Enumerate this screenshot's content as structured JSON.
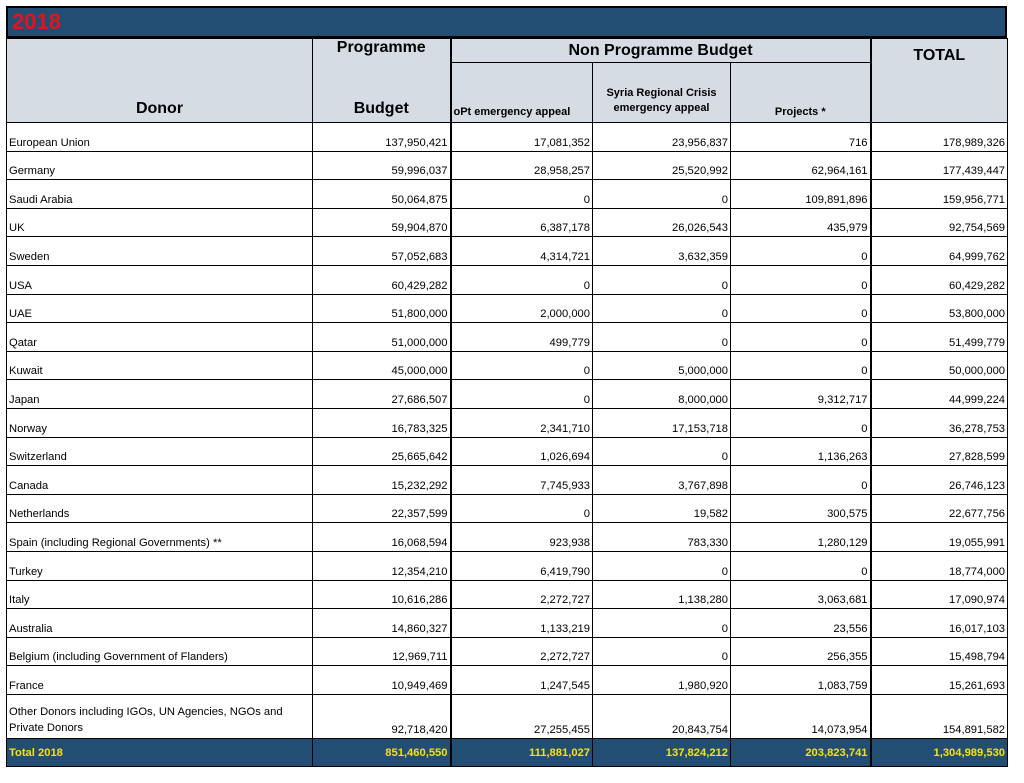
{
  "title": "2018",
  "headers": {
    "donor": "Donor",
    "programme_line1": "Programme",
    "programme_line2": "Budget",
    "non_programme": "Non Programme Budget",
    "opt": "oPt emergency appeal",
    "syria": "Syria Regional Crisis emergency appeal",
    "projects": "Projects *",
    "total": "TOTAL"
  },
  "rows": [
    {
      "donor": "European Union",
      "programme": "137,950,421",
      "opt": "17,081,352",
      "syria": "23,956,837",
      "projects": "716",
      "total": "178,989,326"
    },
    {
      "donor": "Germany",
      "programme": "59,996,037",
      "opt": "28,958,257",
      "syria": "25,520,992",
      "projects": "62,964,161",
      "total": "177,439,447"
    },
    {
      "donor": "Saudi Arabia",
      "programme": "50,064,875",
      "opt": "0",
      "syria": "0",
      "projects": "109,891,896",
      "total": "159,956,771"
    },
    {
      "donor": "UK",
      "programme": "59,904,870",
      "opt": "6,387,178",
      "syria": "26,026,543",
      "projects": "435,979",
      "total": "92,754,569"
    },
    {
      "donor": "Sweden",
      "programme": "57,052,683",
      "opt": "4,314,721",
      "syria": "3,632,359",
      "projects": "0",
      "total": "64,999,762"
    },
    {
      "donor": "USA",
      "programme": "60,429,282",
      "opt": "0",
      "syria": "0",
      "projects": "0",
      "total": "60,429,282"
    },
    {
      "donor": "UAE",
      "programme": "51,800,000",
      "opt": "2,000,000",
      "syria": "0",
      "projects": "0",
      "total": "53,800,000"
    },
    {
      "donor": "Qatar",
      "programme": "51,000,000",
      "opt": "499,779",
      "syria": "0",
      "projects": "0",
      "total": "51,499,779"
    },
    {
      "donor": "Kuwait",
      "programme": "45,000,000",
      "opt": "0",
      "syria": "5,000,000",
      "projects": "0",
      "total": "50,000,000"
    },
    {
      "donor": "Japan",
      "programme": "27,686,507",
      "opt": "0",
      "syria": "8,000,000",
      "projects": "9,312,717",
      "total": "44,999,224"
    },
    {
      "donor": "Norway",
      "programme": "16,783,325",
      "opt": "2,341,710",
      "syria": "17,153,718",
      "projects": "0",
      "total": "36,278,753"
    },
    {
      "donor": "Switzerland",
      "programme": "25,665,642",
      "opt": "1,026,694",
      "syria": "0",
      "projects": "1,136,263",
      "total": "27,828,599"
    },
    {
      "donor": "Canada",
      "programme": "15,232,292",
      "opt": "7,745,933",
      "syria": "3,767,898",
      "projects": "0",
      "total": "26,746,123"
    },
    {
      "donor": "Netherlands",
      "programme": "22,357,599",
      "opt": "0",
      "syria": "19,582",
      "projects": "300,575",
      "total": "22,677,756"
    },
    {
      "donor": "Spain (including Regional Governments) **",
      "programme": "16,068,594",
      "opt": "923,938",
      "syria": "783,330",
      "projects": "1,280,129",
      "total": "19,055,991"
    },
    {
      "donor": "Turkey",
      "programme": "12,354,210",
      "opt": "6,419,790",
      "syria": "0",
      "projects": "0",
      "total": "18,774,000"
    },
    {
      "donor": "Italy",
      "programme": "10,616,286",
      "opt": "2,272,727",
      "syria": "1,138,280",
      "projects": "3,063,681",
      "total": "17,090,974"
    },
    {
      "donor": "Australia",
      "programme": "14,860,327",
      "opt": "1,133,219",
      "syria": "0",
      "projects": "23,556",
      "total": "16,017,103"
    },
    {
      "donor": "Belgium (including Government of Flanders)",
      "programme": "12,969,711",
      "opt": "2,272,727",
      "syria": "0",
      "projects": "256,355",
      "total": "15,498,794"
    },
    {
      "donor": "France",
      "programme": "10,949,469",
      "opt": "1,247,545",
      "syria": "1,980,920",
      "projects": "1,083,759",
      "total": "15,261,693"
    },
    {
      "donor": "Other Donors including IGOs, UN Agencies, NGOs and Private Donors",
      "programme": "92,718,420",
      "opt": "27,255,455",
      "syria": "20,843,754",
      "projects": "14,073,954",
      "total": "154,891,582"
    }
  ],
  "total_row": {
    "donor": "Total 2018",
    "programme": "851,460,550",
    "opt": "111,881,027",
    "syria": "137,824,212",
    "projects": "203,823,741",
    "total": "1,304,989,530"
  },
  "colors": {
    "header_bg": "#d6dce4",
    "bar_bg": "#234e74",
    "title_text": "#e8101a",
    "total_text": "#f6e20c"
  }
}
